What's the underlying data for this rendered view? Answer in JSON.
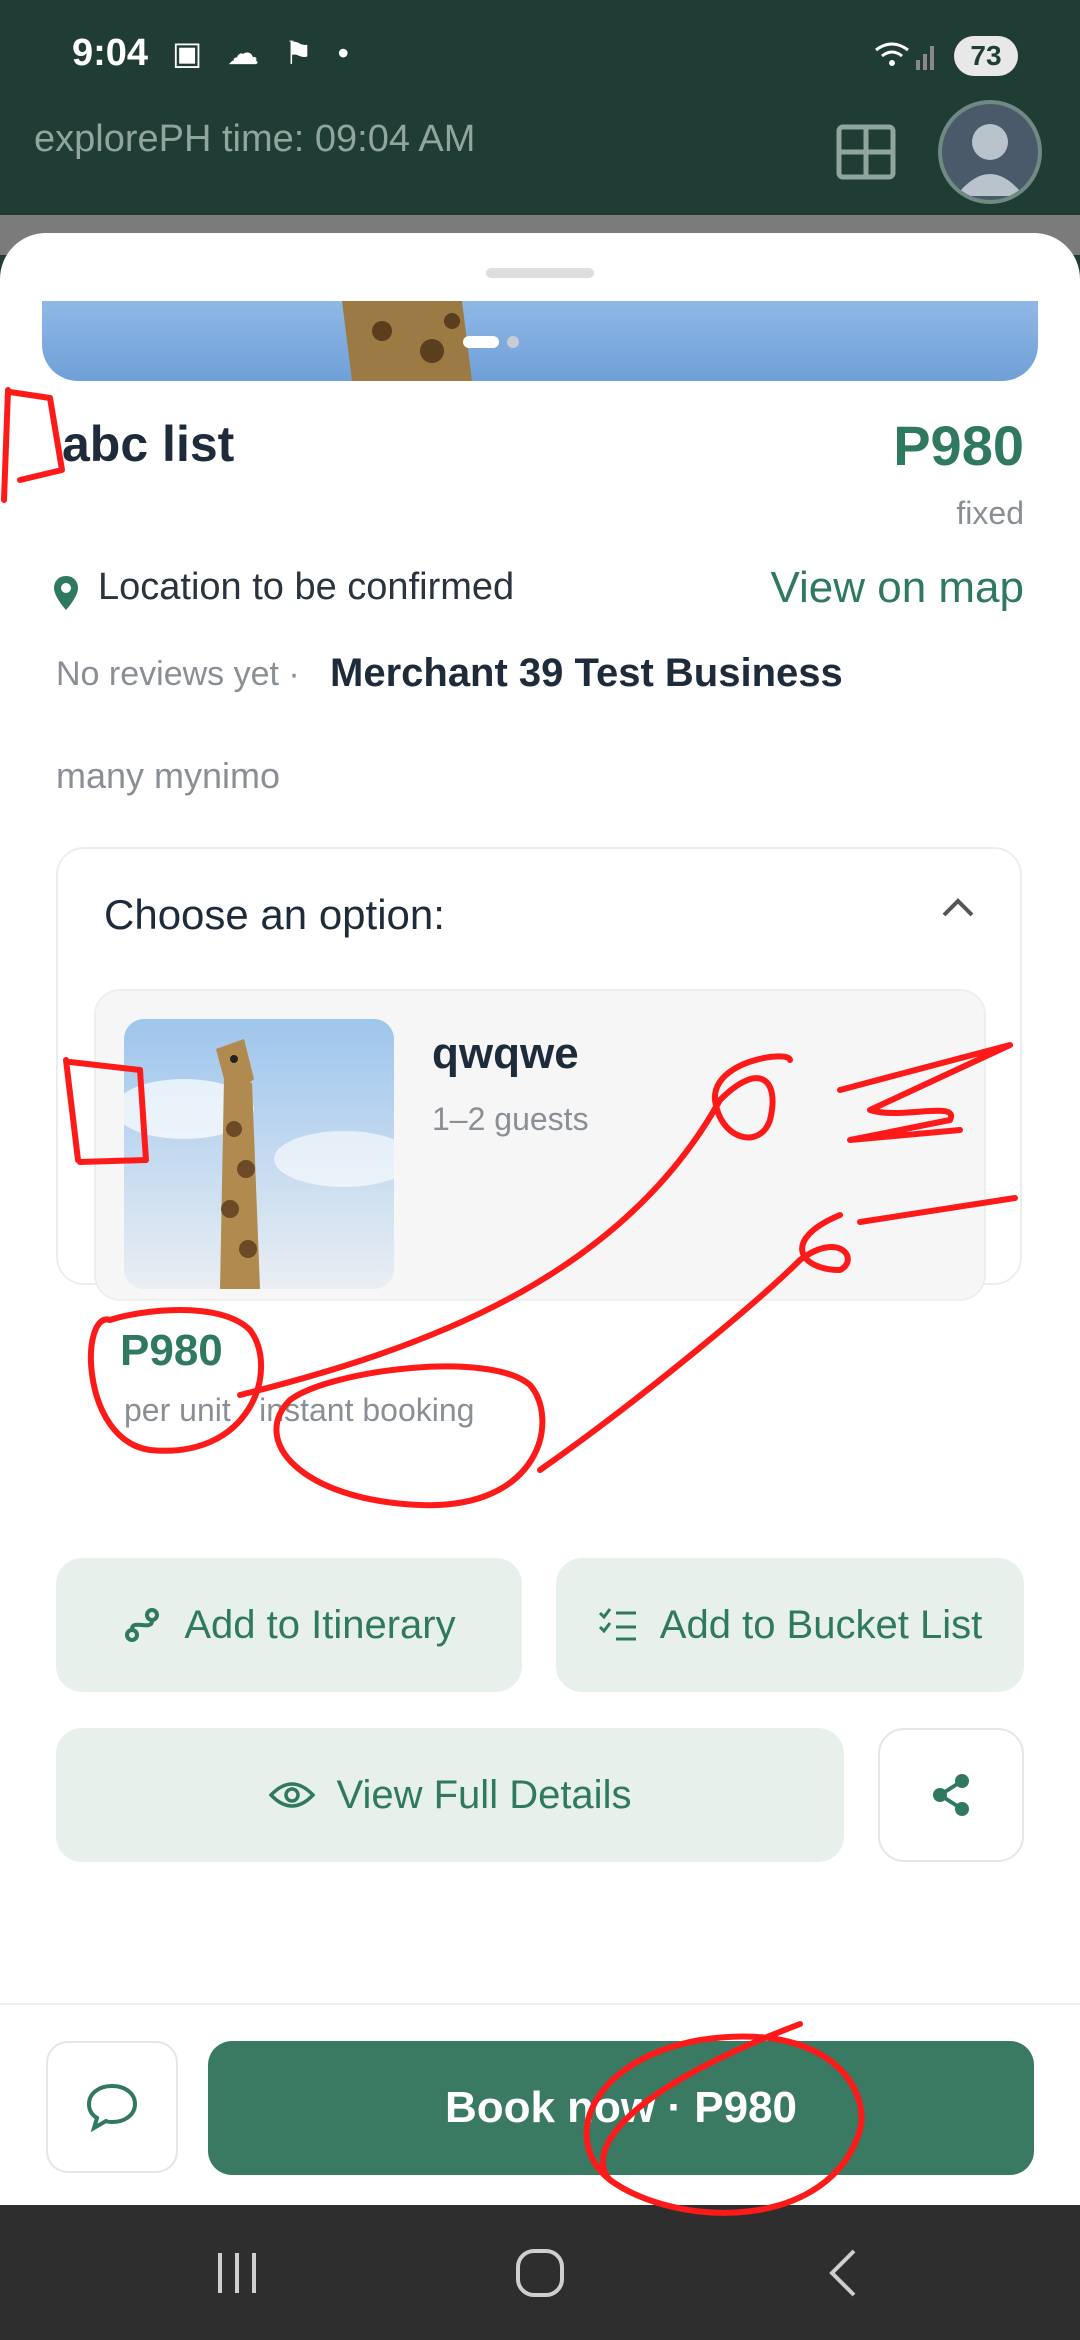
{
  "status_bar": {
    "time": "9:04",
    "battery": "73"
  },
  "header": {
    "time_label": "explorePH time: 09:04 AM",
    "grid_icon": "grid-icon",
    "avatar_icon": "user-avatar-icon"
  },
  "listing": {
    "title": "abc list",
    "price": "P980",
    "price_type": "fixed",
    "location": "Location to be confirmed",
    "view_on_map": "View on map",
    "reviews": "No reviews yet ·",
    "merchant": "Merchant 39 Test Business",
    "description": "many mynimo"
  },
  "options": {
    "heading": "Choose an option:",
    "items": [
      {
        "name": "qwqwe",
        "guests": "1–2 guests",
        "price": "P980",
        "meta": "per unit · instant booking"
      }
    ]
  },
  "actions": {
    "add_itinerary": "Add to Itinerary",
    "add_bucket": "Add to Bucket List",
    "view_details": "View Full Details"
  },
  "bottom": {
    "book_label": "Book now · P980"
  },
  "colors": {
    "brand": "#2f7a5e",
    "header_bg": "#1f3d34",
    "annotation": "#ff1a1a"
  }
}
